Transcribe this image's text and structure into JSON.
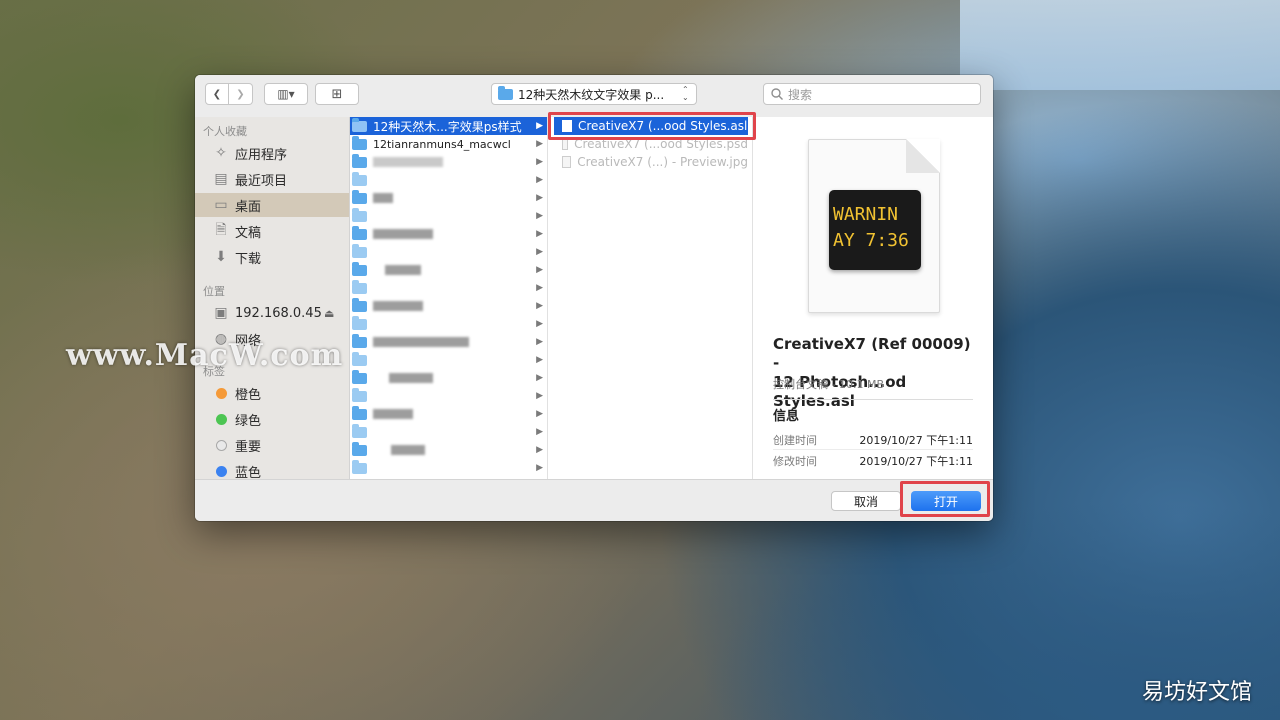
{
  "toolbar": {
    "back_glyph": "❮",
    "forward_glyph": "❯",
    "view_glyph": "▥▾",
    "new_folder_glyph": "⊞",
    "location": "12种天然木纹文字效果 p...",
    "location_chevron": "⌃⌄",
    "search_placeholder": "搜索"
  },
  "sidebar": {
    "favorites_header": "个人收藏",
    "favorites": [
      {
        "label": "应用程序",
        "icon": "applications-icon"
      },
      {
        "label": "最近项目",
        "icon": "recents-icon"
      },
      {
        "label": "桌面",
        "icon": "desktop-icon"
      },
      {
        "label": "文稿",
        "icon": "documents-icon"
      },
      {
        "label": "下载",
        "icon": "downloads-icon"
      }
    ],
    "locations_header": "位置",
    "locations": [
      {
        "label": "192.168.0.45",
        "icon": "computer-icon",
        "eject": "⏏"
      },
      {
        "label": "网络",
        "icon": "network-icon"
      }
    ],
    "tags_header": "标签",
    "tags": [
      {
        "label": "橙色",
        "color": "#f59a38"
      },
      {
        "label": "绿色",
        "color": "#4cc552"
      },
      {
        "label": "重要",
        "color": "#d8d8d8"
      },
      {
        "label": "蓝色",
        "color": "#3b82f0"
      }
    ]
  },
  "column1": {
    "selected": "12种天然木...字效果ps样式",
    "second": "12tianranmuns4_macwcl"
  },
  "column2": {
    "files": [
      {
        "label": "CreativeX7 (...ood Styles.asl",
        "selected": true
      },
      {
        "label": "CreativeX7 (...ood Styles.psd",
        "selected": false
      },
      {
        "label": "CreativeX7 (...) - Preview.jpg",
        "selected": false
      }
    ]
  },
  "preview": {
    "console_line1": "WARNIN",
    "console_line2": "AY 7:36",
    "title_line1": "CreativeX7 (Ref 00009) -",
    "title_line2": "12 Photosh...od Styles.asl",
    "subtitle": "控制台文稿 - 10.1 MB",
    "info_header": "信息",
    "created_label": "创建时间",
    "created_value": "2019/10/27 下午1:11",
    "modified_label": "修改时间",
    "modified_value": "2019/10/27 下午1:11"
  },
  "buttons": {
    "cancel": "取消",
    "open": "打开"
  },
  "overlay": {
    "watermark": "www.MacW.com",
    "corner_brand": "易坊好文馆"
  }
}
